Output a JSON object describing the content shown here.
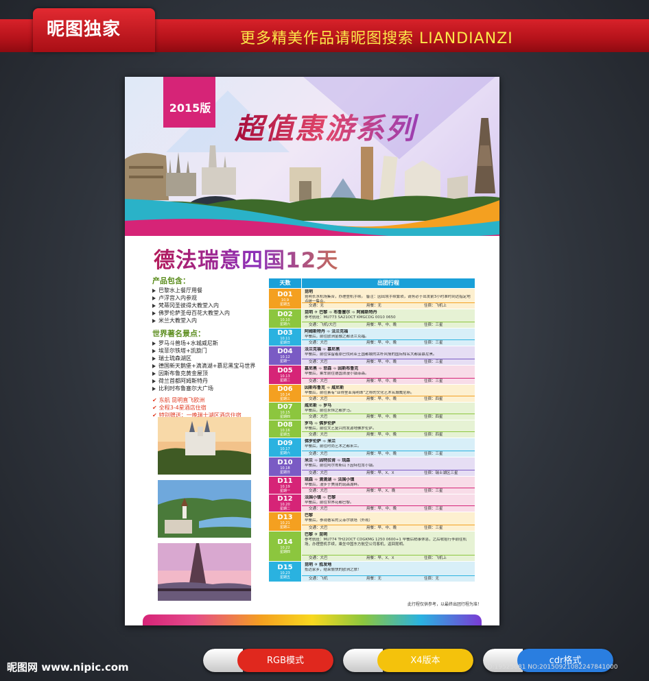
{
  "banner": {
    "brand": "昵图独家",
    "slogan": "更多精美作品请昵图搜索  LIANDIANZI"
  },
  "poster": {
    "edition": "2015版",
    "series_title": "超值惠游系列",
    "route_title": "德法瑞意四国12天",
    "includes_heading": "产品包含：",
    "includes": [
      "巴黎水上餐厅用餐",
      "卢浮宫入内参观",
      "梵蒂冈圣彼得大教堂入内",
      "佛罗伦萨圣母百花大教堂入内",
      "米兰大教堂入内"
    ],
    "sights_heading": "世界著名景点：",
    "sights": [
      "罗马斗兽场+水城威尼斯",
      "埃菲尔铁塔+凯旋门",
      "瑞士琉森湖区",
      "德国新天鹅堡+滴滴湖+慕尼黑宝马世界",
      "因斯布鲁克黄金屋顶",
      "荷兰首都阿姆斯特丹",
      "比利时布鲁塞尔大广场"
    ],
    "notes": [
      "东航 昆明直飞欧洲",
      "全程3-4星酒店住宿",
      "特别赠送：一晚瑞士湖区酒店住宿"
    ],
    "table_head": {
      "day": "天数",
      "plan": "出团行程"
    },
    "days": [
      {
        "code": "D01",
        "date": "10.9",
        "week": "星期五",
        "route": "昆明",
        "desc": "昆明长水机场集合，办理登机手续。 备注：因出境手续繁琐，请务必于出发前3小时准时到达指定地点统一集合。",
        "transport": "交通：无",
        "meals": "用餐：无",
        "hotel": "住宿：飞机上",
        "color": "#f4a020",
        "bg": "#fdf0d0"
      },
      {
        "code": "D02",
        "date": "10.10",
        "week": "星期六",
        "route": "昆明 ✈ 巴黎 ➾ 布鲁塞尔 ➾ 阿姆斯特丹",
        "desc": "参考航班：MU773 SA21OCT KMGCDG 0010 0650",
        "transport": "交通：飞机/大巴",
        "meals": "用餐：早、中、晚",
        "hotel": "住宿：三星",
        "color": "#8cc63e",
        "bg": "#e6f2d4"
      },
      {
        "code": "D03",
        "date": "10.11",
        "week": "星期日",
        "route": "阿姆斯特丹 ➾ 法兰克福",
        "desc": "早餐后，前往欧洲金融之都法兰克福。",
        "transport": "交通：大巴",
        "meals": "用餐：早、中、晚",
        "hotel": "住宿：三星",
        "color": "#2ab2e0",
        "bg": "#d8eff8"
      },
      {
        "code": "D04",
        "date": "10.12",
        "week": "星期一",
        "route": "法兰克福 ➾ 慕尼黑",
        "desc": "早餐后，前往保留着原巴伐利亚王国都城的古朴风情的国际知名大都会慕尼黑。",
        "transport": "交通：大巴",
        "meals": "用餐：早、中、晚",
        "hotel": "住宿：三星",
        "color": "#7a5bc4",
        "bg": "#e6def4"
      },
      {
        "code": "D05",
        "date": "10.13",
        "week": "星期二",
        "route": "慕尼黑 ➾ 菲森 ➾ 因斯布鲁克",
        "desc": "早餐后，乘车前往德国浪漫小镇菲森。",
        "transport": "交通：大巴",
        "meals": "用餐：早、中、晚",
        "hotel": "住宿：三星",
        "color": "#d62477",
        "bg": "#f8dce8"
      },
      {
        "code": "D06",
        "date": "10.14",
        "week": "星期三",
        "route": "因斯布鲁克 ➾ 威尼斯",
        "desc": "早餐后，前往素有“亚得里亚海明珠”之称的文化艺术名城威尼斯。",
        "transport": "交通：大巴",
        "meals": "用餐：早、中、晚",
        "hotel": "住宿：四星",
        "color": "#f4a020",
        "bg": "#fdf0d0"
      },
      {
        "code": "D07",
        "date": "10.15",
        "week": "星期四",
        "route": "威尼斯 ➾ 罗马",
        "desc": "早餐后，前往永恒之都罗马。",
        "transport": "交通：大巴",
        "meals": "用餐：早、中、晚",
        "hotel": "住宿：四星",
        "color": "#8cc63e",
        "bg": "#e6f2d4"
      },
      {
        "code": "D08",
        "date": "10.16",
        "week": "星期五",
        "route": "罗马 ➾ 佛罗伦萨",
        "desc": "早餐后，前往文艺复兴的发源地佛罗伦萨。",
        "transport": "交通：大巴",
        "meals": "用餐：早、中、晚",
        "hotel": "住宿：四星",
        "color": "#8cc63e",
        "bg": "#e6f2d4"
      },
      {
        "code": "D09",
        "date": "10.17",
        "week": "星期六",
        "route": "佛罗伦萨 ➾ 米兰",
        "desc": "早餐后，前往时尚艺术之都米兰。",
        "transport": "交通：大巴",
        "meals": "用餐：早、中、晚",
        "hotel": "住宿：三星",
        "color": "#2ab2e0",
        "bg": "#d8eff8"
      },
      {
        "code": "D10",
        "date": "10.18",
        "week": "星期日",
        "route": "米兰 ➾ 因特拉肯 ➾ 琉森",
        "desc": "早餐后，前往阿尔卑斯山下因特拉肯小镇。",
        "transport": "交通：大巴",
        "meals": "用餐：早、X、X",
        "hotel": "住宿：瑞士湖区三星",
        "color": "#7a5bc4",
        "bg": "#e6def4"
      },
      {
        "code": "D11",
        "date": "10.19",
        "week": "星期一",
        "route": "琉森 ➾ 滴滴湖 ➾ 法国小镇",
        "desc": "早餐后，漫步于美丽的琉森湖畔。",
        "transport": "交通：大巴",
        "meals": "用餐：早、X、晚",
        "hotel": "住宿：三星",
        "color": "#d62477",
        "bg": "#f8dce8"
      },
      {
        "code": "D12",
        "date": "10.20",
        "week": "星期二",
        "route": "法国小镇 ➾ 巴黎",
        "desc": "早餐后，前往世界花都巴黎。",
        "transport": "交通：大巴",
        "meals": "用餐：早、中、晚",
        "hotel": "住宿：三星",
        "color": "#d62477",
        "bg": "#f8dce8"
      },
      {
        "code": "D13",
        "date": "10.21",
        "week": "星期三",
        "route": "巴黎",
        "desc": "早餐后，参观著名的艾菲尔铁塔（外观）",
        "transport": "交通：大巴",
        "meals": "用餐：早、中、晚",
        "hotel": "住宿：三星",
        "color": "#f4a020",
        "bg": "#fdf0d0"
      },
      {
        "code": "D14",
        "date": "10.22",
        "week": "星期四",
        "route": "巴黎 ✈ 昆明",
        "desc": "参考航班：MU774 TH22OCT CDGKMG 1250 0600+1 早餐后稍事休息，之后收拾行李前往机场，办理登机手续，乘坐中国东方航空公司客机，返回昆明。",
        "transport": "交通：大巴",
        "meals": "用餐：早、X、X",
        "hotel": "住宿：飞机上",
        "color": "#8cc63e",
        "bg": "#e6f2d4"
      },
      {
        "code": "D15",
        "date": "10.23",
        "week": "星期五",
        "route": "昆明 ✈ 抵发地",
        "desc": "抵达家乡，结束愉快的欧洲之旅！",
        "transport": "交通：飞机",
        "meals": "用餐：无",
        "hotel": "住宿：无",
        "color": "#2ab2e0",
        "bg": "#d8eff8"
      }
    ],
    "disclaimer": "此行程仅供参考，以最终出团行程为准！"
  },
  "footer": {
    "site": "昵图网 www.nipic.com",
    "pills": [
      {
        "label": "RGB模式",
        "color": "#e0281e"
      },
      {
        "label": "X4版本",
        "color": "#f4c20c"
      },
      {
        "label": "cdr格式",
        "color": "#2a7ee0"
      }
    ],
    "id_text": "ID:19525081 NO:20150921082247841000"
  }
}
